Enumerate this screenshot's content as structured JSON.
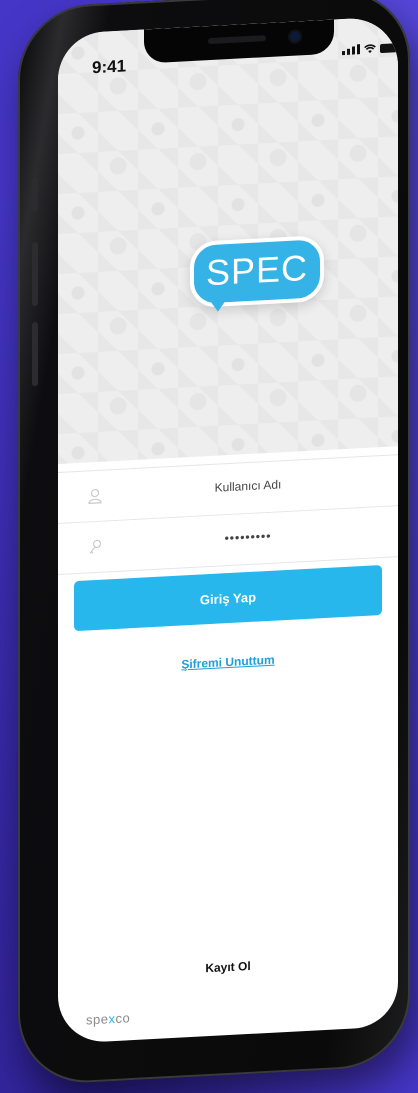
{
  "status_bar": {
    "time": "9:41",
    "icons": [
      "signal-icon",
      "wifi-icon",
      "battery-icon"
    ]
  },
  "brand": {
    "logo_text": "SPEC",
    "logo_color": "#35b2e6",
    "footer_logo_prefix": "spe",
    "footer_logo_x": "x",
    "footer_logo_suffix": "co"
  },
  "login_form": {
    "username_placeholder": "Kullanıcı Adı",
    "password_value": "•••••••••",
    "username_icon": "user-icon",
    "password_icon": "key-icon",
    "login_button_label": "Giriş Yap",
    "forgot_password_link": "Şifremi Unuttum",
    "register_link": "Kayıt Ol"
  },
  "colors": {
    "background": "#4636c8",
    "accent": "#27b7ec",
    "link": "#1d9fd8"
  }
}
